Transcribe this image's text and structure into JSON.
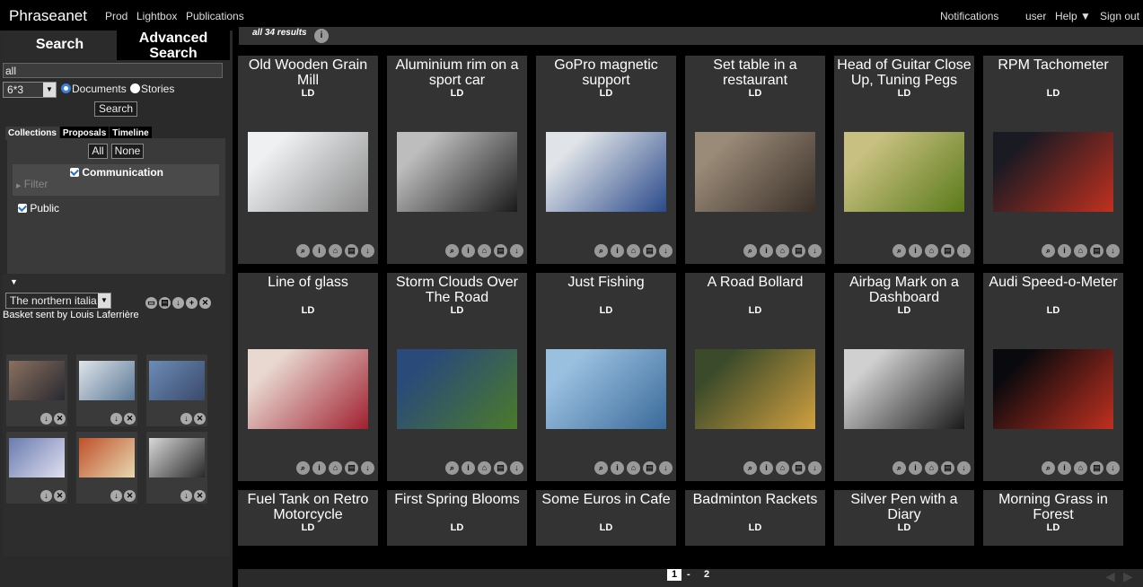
{
  "app": {
    "brand": "Phraseanet"
  },
  "topnav": {
    "left": [
      "Prod",
      "Lightbox",
      "Publications"
    ],
    "notifications": "Notifications",
    "user": "user",
    "help": "Help ▼",
    "signout": "Sign out"
  },
  "search": {
    "tab_search": "Search",
    "tab_advanced_line1": "Advanced",
    "tab_advanced_line2": "Search",
    "query": "all",
    "layout_value": "6*3",
    "radio_documents": "Documents",
    "radio_stories": "Stories",
    "button": "Search",
    "tabs": [
      "Collections",
      "Proposals",
      "Timeline"
    ],
    "all_btn": "All",
    "none_btn": "None",
    "communication": "Communication",
    "filter": "Filter",
    "public": "Public"
  },
  "basket": {
    "select_value": "The northern italia",
    "sent_by": "Basket sent by Louis Laferrière",
    "thumbs": [
      {
        "colors": [
          "#8a7060",
          "#2a2a30"
        ]
      },
      {
        "colors": [
          "#dfe4ea",
          "#5b7896"
        ]
      },
      {
        "colors": [
          "#6c8cb8",
          "#3a4a6a"
        ]
      },
      {
        "colors": [
          "#6a7bb0",
          "#e0e0f0"
        ]
      },
      {
        "colors": [
          "#c0502a",
          "#e8d8b0"
        ]
      },
      {
        "colors": [
          "#d8d8d8",
          "#2a2a2a"
        ]
      }
    ]
  },
  "results": {
    "count_text": "all 34 results",
    "ld_label": "LD",
    "cards": [
      {
        "title": "Old Wooden Grain Mill",
        "colors": [
          "#eef0f2",
          "#8a8a8a"
        ]
      },
      {
        "title": "Aluminium rim on a sport car",
        "colors": [
          "#bdbdbd",
          "#1a1a1a"
        ]
      },
      {
        "title": "GoPro magnetic support",
        "colors": [
          "#e0e4e8",
          "#2a4a8a"
        ]
      },
      {
        "title": "Set table in a restaurant",
        "colors": [
          "#9a8a78",
          "#3a3028"
        ]
      },
      {
        "title": "Head of Guitar Close Up, Tuning Pegs",
        "colors": [
          "#c8c080",
          "#5a7a1a"
        ]
      },
      {
        "title": "RPM Tachometer",
        "colors": [
          "#1a1a22",
          "#c03020"
        ]
      },
      {
        "title": "Line of glass",
        "colors": [
          "#e8d8d0",
          "#a02030"
        ]
      },
      {
        "title": "Storm Clouds Over The Road",
        "colors": [
          "#2a4a7a",
          "#4a7a2a"
        ]
      },
      {
        "title": "Just Fishing",
        "colors": [
          "#9ac0e0",
          "#3a6a9a"
        ]
      },
      {
        "title": "A Road Bollard",
        "colors": [
          "#3a4a2a",
          "#d0a040"
        ]
      },
      {
        "title": "Airbag Mark on a Dashboard",
        "colors": [
          "#d0d0d0",
          "#1a1a1a"
        ]
      },
      {
        "title": "Audi Speed-o-Meter",
        "colors": [
          "#0a0a0e",
          "#c03020"
        ]
      },
      {
        "title": "Fuel Tank on Retro Motorcycle"
      },
      {
        "title": "First Spring Blooms"
      },
      {
        "title": "Some Euros in Cafe"
      },
      {
        "title": "Badminton Rackets"
      },
      {
        "title": "Silver Pen with a Diary"
      },
      {
        "title": "Morning Grass in Forest"
      }
    ]
  },
  "pager": {
    "current": "1",
    "sep": "-",
    "next": "2"
  }
}
